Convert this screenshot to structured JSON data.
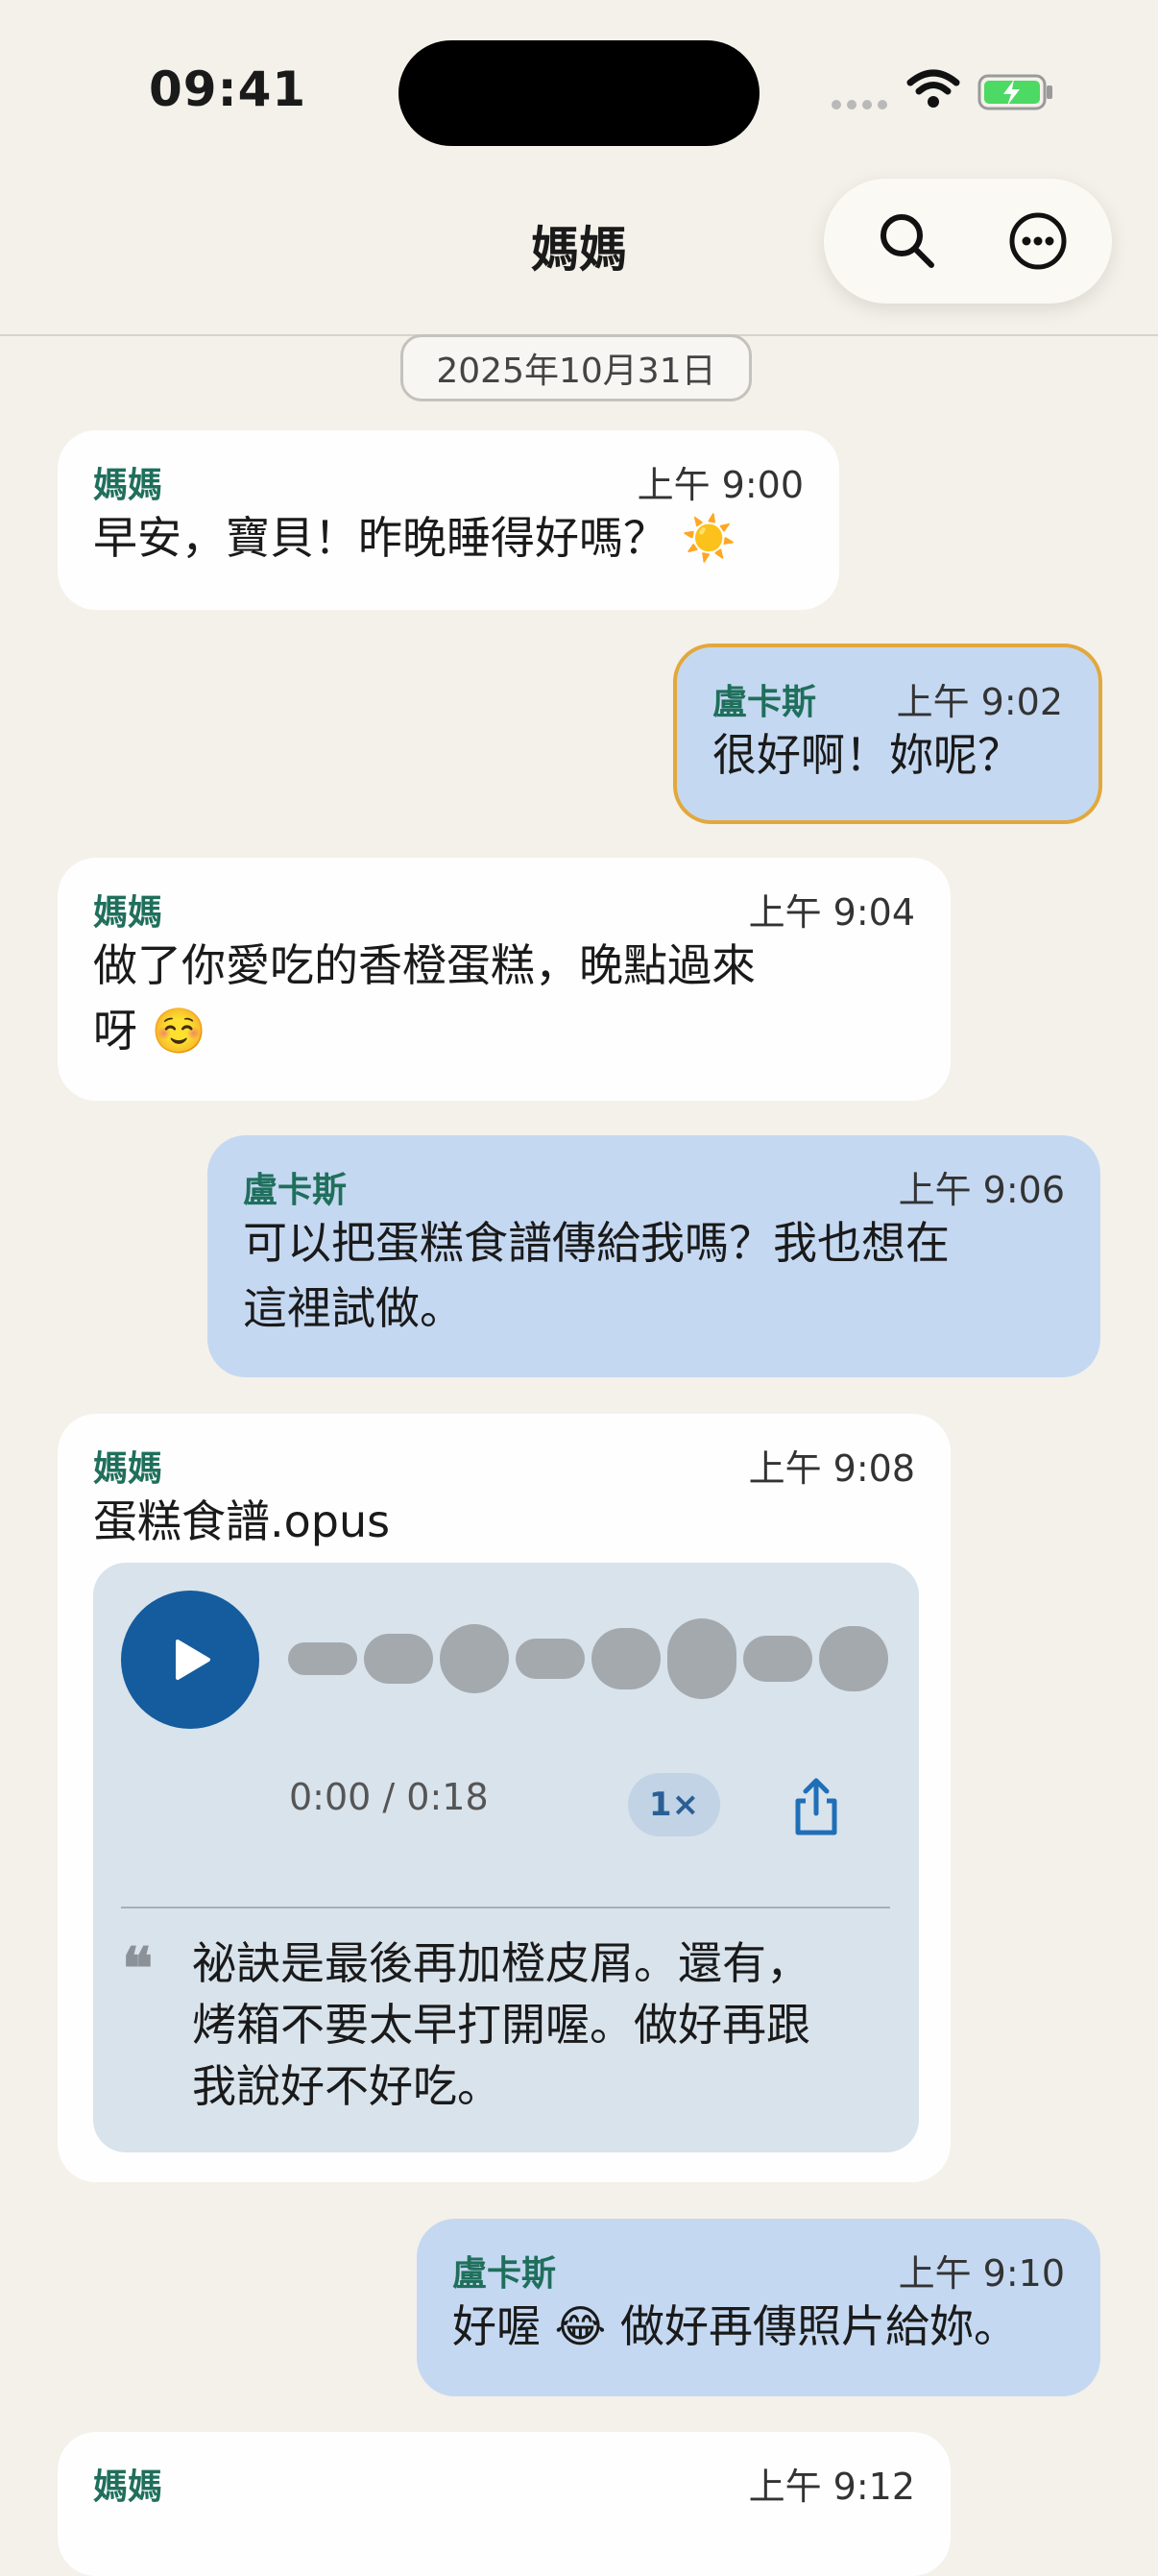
{
  "status_bar": {
    "time": "09:41"
  },
  "header": {
    "title": "媽媽",
    "search_icon": "search-icon",
    "more_icon": "more-icon"
  },
  "date_chip": "2025年10月31日",
  "colors": {
    "background": "#f4f1ea",
    "incoming": "#fefefe",
    "outgoing": "#c5d8f1",
    "sender": "#1f6f5c",
    "highlight": "#e2a83b",
    "play": "#145c9e"
  },
  "messages": [
    {
      "sender": "媽媽",
      "time": "上午 9:00",
      "text": "早安，寶貝！昨晚睡得好嗎？ ☀️"
    },
    {
      "sender": "盧卡斯",
      "time": "上午 9:02",
      "text": "很好啊！妳呢？"
    },
    {
      "sender": "媽媽",
      "time": "上午 9:04",
      "text_line1": "做了你愛吃的香橙蛋糕，晚點過來",
      "text_line2": "呀 ☺️"
    },
    {
      "sender": "盧卡斯",
      "time": "上午 9:06",
      "text_line1": "可以把蛋糕食譜傳給我嗎？我也想在",
      "text_line2": "這裡試做。"
    },
    {
      "sender": "媽媽",
      "time": "上午 9:08",
      "file_name": "蛋糕食譜.opus",
      "voice": {
        "duration_text": "0:00 / 0:18",
        "speed": "1×",
        "transcript_line1": "祕訣是最後再加橙皮屑。還有，",
        "transcript_line2": "烤箱不要太早打開喔。做好再跟",
        "transcript_line3": "我說好不好吃。"
      }
    },
    {
      "sender": "盧卡斯",
      "time": "上午 9:10",
      "text": "好喔 😂 做好再傳照片給妳。"
    },
    {
      "sender": "媽媽",
      "time": "上午 9:12"
    }
  ]
}
